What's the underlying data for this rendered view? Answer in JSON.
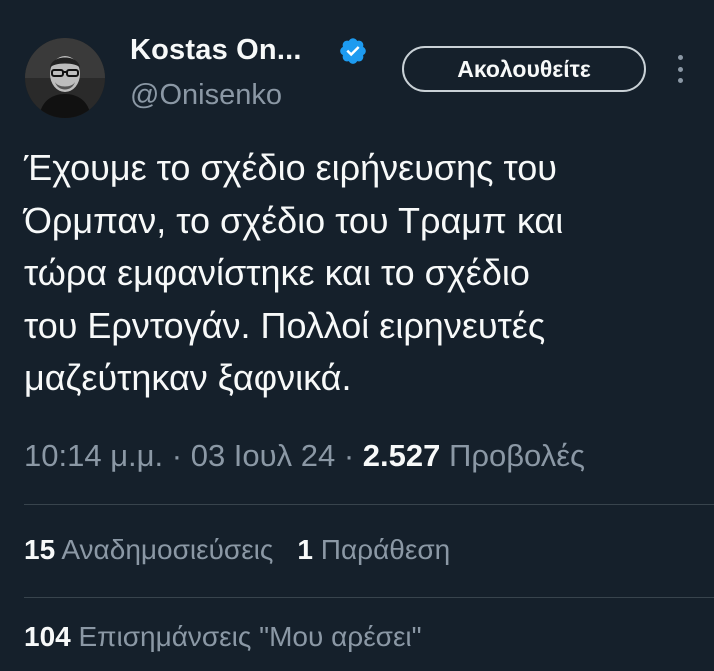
{
  "author": {
    "display_name": "Kostas On...",
    "handle": "@Onisenko",
    "verified": true
  },
  "header": {
    "follow_label": "Ακολουθείτε",
    "more_icon": "more-vertical-icon"
  },
  "tweet": {
    "lines": [
      "Έχουμε το σχέδιο ειρήνευσης του",
      "Όρμπαν, το σχέδιο του Τραμπ και",
      "τώρα εμφανίστηκε και το σχέδιο",
      "του Ερντογάν. Πολλοί ειρηνευτές",
      "μαζεύτηκαν ξαφνικά."
    ]
  },
  "meta": {
    "time": "10:14 μ.μ.",
    "date": "03 Ιουλ 24",
    "separator": " · ",
    "views_count": "2.527",
    "views_label": "Προβολές"
  },
  "stats": {
    "reposts_count": "15",
    "reposts_label": "Αναδημοσιεύσεις",
    "quotes_count": "1",
    "quotes_label": "Παράθεση",
    "likes_count": "104",
    "likes_label": "Επισημάνσεις \"Μου αρέσει\""
  },
  "colors": {
    "background": "#15202b",
    "text": "#f7f9f9",
    "secondary": "#8b98a5",
    "verified": "#1d9bf0",
    "divider": "#38444d"
  }
}
